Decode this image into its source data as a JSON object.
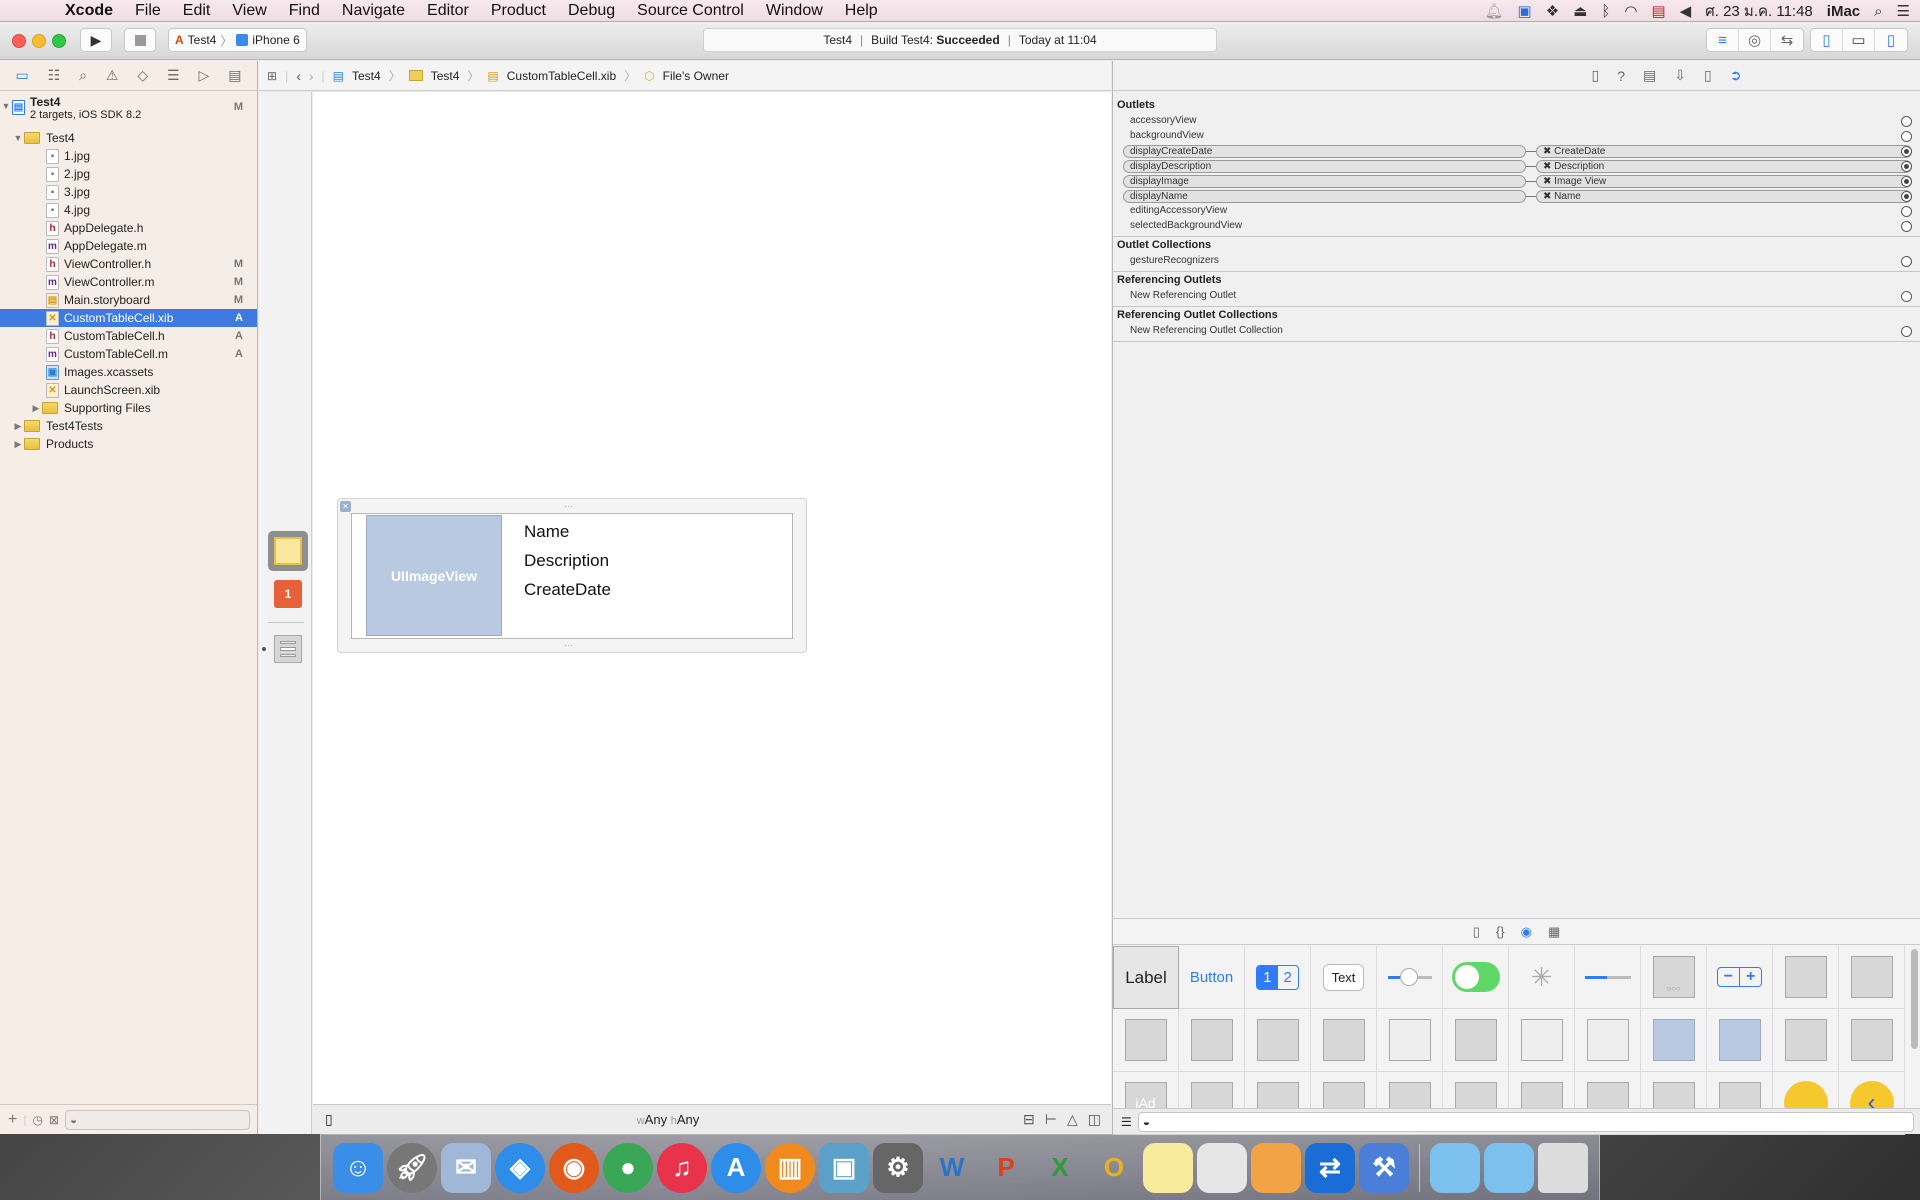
{
  "menubar": {
    "app_name": "Xcode",
    "items": [
      "File",
      "Edit",
      "View",
      "Find",
      "Navigate",
      "Editor",
      "Product",
      "Debug",
      "Source Control",
      "Window",
      "Help"
    ],
    "clock": "ศ. 23 ม.ค. 11:48",
    "user": "iMac"
  },
  "toolbar": {
    "scheme": "Test4",
    "device": "iPhone 6",
    "status": {
      "project": "Test4",
      "build_prefix": "Build Test4:",
      "build_result": "Succeeded",
      "time": "Today at 11:04"
    }
  },
  "navigator": {
    "project": {
      "name": "Test4",
      "subtitle": "2 targets, iOS SDK 8.2",
      "badge": "M"
    },
    "items": [
      {
        "label": "Test4",
        "type": "folder",
        "badge": ""
      },
      {
        "label": "1.jpg",
        "type": "img",
        "badge": ""
      },
      {
        "label": "2.jpg",
        "type": "img",
        "badge": ""
      },
      {
        "label": "3.jpg",
        "type": "img",
        "badge": ""
      },
      {
        "label": "4.jpg",
        "type": "img",
        "badge": ""
      },
      {
        "label": "AppDelegate.h",
        "type": "h",
        "badge": ""
      },
      {
        "label": "AppDelegate.m",
        "type": "m",
        "badge": ""
      },
      {
        "label": "ViewController.h",
        "type": "h",
        "badge": "M"
      },
      {
        "label": "ViewController.m",
        "type": "m",
        "badge": "M"
      },
      {
        "label": "Main.storyboard",
        "type": "sb",
        "badge": "M"
      },
      {
        "label": "CustomTableCell.xib",
        "type": "xib",
        "badge": "A"
      },
      {
        "label": "CustomTableCell.h",
        "type": "h",
        "badge": "A"
      },
      {
        "label": "CustomTableCell.m",
        "type": "m",
        "badge": "A"
      },
      {
        "label": "Images.xcassets",
        "type": "assets",
        "badge": ""
      },
      {
        "label": "LaunchScreen.xib",
        "type": "xib",
        "badge": ""
      },
      {
        "label": "Supporting Files",
        "type": "folder",
        "badge": ""
      },
      {
        "label": "Test4Tests",
        "type": "folder",
        "badge": ""
      },
      {
        "label": "Products",
        "type": "folder",
        "badge": ""
      }
    ]
  },
  "jumpbar": {
    "crumbs": [
      "Test4",
      "Test4",
      "CustomTableCell.xib",
      "File's Owner"
    ]
  },
  "canvas": {
    "image_view_label": "UIImageView",
    "labels": [
      "Name",
      "Description",
      "CreateDate"
    ],
    "size_class_w_prefix": "w",
    "size_class_w": "Any",
    "size_class_h_prefix": "h",
    "size_class_h": "Any"
  },
  "inspector": {
    "sections": {
      "outlets": "Outlets",
      "outlet_collections": "Outlet Collections",
      "referencing_outlets": "Referencing Outlets",
      "referencing_outlet_collections": "Referencing Outlet Collections"
    },
    "outlets": [
      {
        "name": "accessoryView",
        "target": "",
        "connected": false
      },
      {
        "name": "backgroundView",
        "target": "",
        "connected": false
      },
      {
        "name": "displayCreateDate",
        "target": "CreateDate",
        "connected": true
      },
      {
        "name": "displayDescription",
        "target": "Description",
        "connected": true
      },
      {
        "name": "displayImage",
        "target": "Image View",
        "connected": true
      },
      {
        "name": "displayName",
        "target": "Name",
        "connected": true
      },
      {
        "name": "editingAccessoryView",
        "target": "",
        "connected": false
      },
      {
        "name": "selectedBackgroundView",
        "target": "",
        "connected": false
      }
    ],
    "collections": [
      "gestureRecognizers"
    ],
    "referencing": [
      "New Referencing Outlet"
    ],
    "referencing_collections": [
      "New Referencing Outlet Collection"
    ]
  },
  "library": {
    "row1": [
      "Label",
      "Button",
      "1",
      "2",
      "Text"
    ]
  },
  "dock": {
    "apps": [
      "Finder",
      "Launchpad",
      "Mail",
      "Safari",
      "Firefox",
      "Chrome",
      "iTunes",
      "App Store",
      "iBooks",
      "iPhoto",
      "System Preferences",
      "Word",
      "PowerPoint",
      "Excel",
      "Outlook",
      "Notes",
      "Preview",
      "Pages",
      "TeamViewer",
      "Xcode",
      "Applications",
      "Documents",
      "Trash"
    ]
  }
}
